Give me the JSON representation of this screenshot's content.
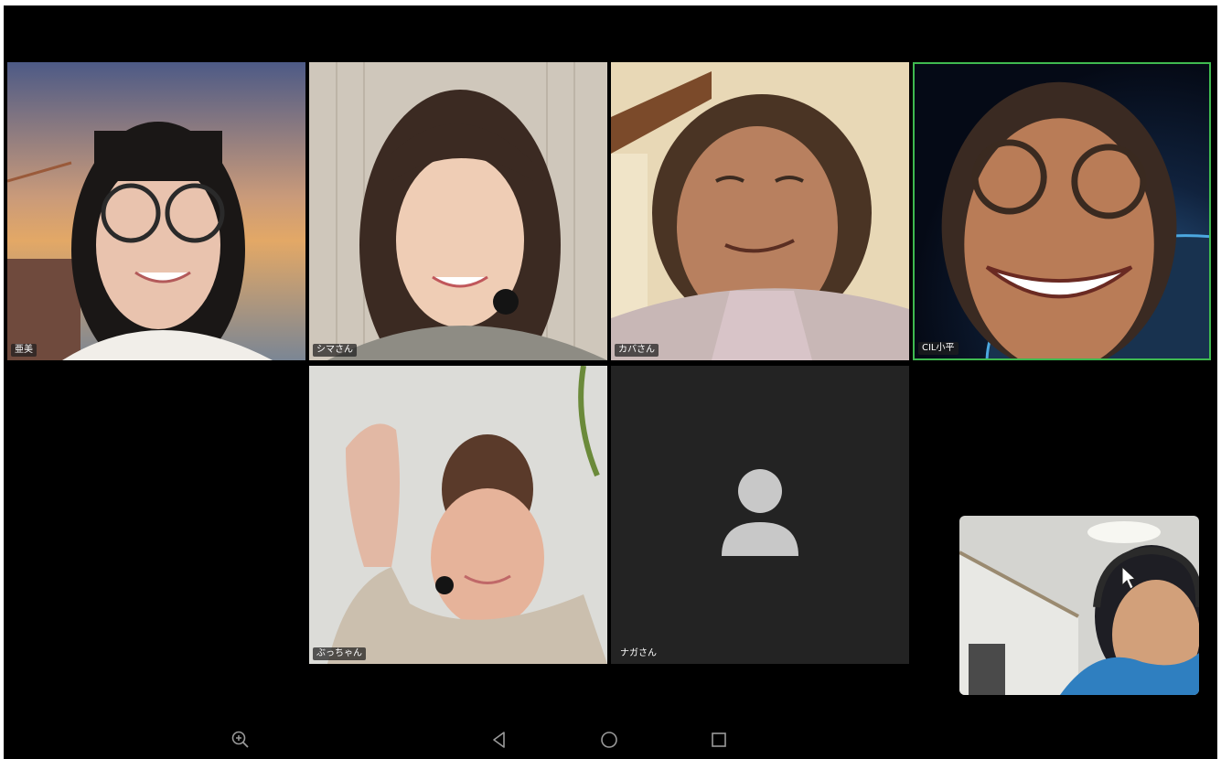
{
  "meeting": {
    "participants": [
      {
        "name": "亜美",
        "video": "on"
      },
      {
        "name": "シマさん",
        "video": "on"
      },
      {
        "name": "カバさん",
        "video": "on"
      },
      {
        "name": "CIL小平",
        "video": "on",
        "active_speaker": true
      },
      {
        "name": "ぶっちゃん",
        "video": "on"
      },
      {
        "name": "ナガさん",
        "video": "off"
      }
    ],
    "self_view": {
      "video": "on"
    }
  },
  "navbar": {
    "buttons": [
      "zoom-in-icon",
      "back-icon",
      "home-icon",
      "recents-icon"
    ]
  },
  "colors": {
    "background": "#000000",
    "active_border": "#3fb950",
    "avatar_tile": "#232323",
    "avatar_glyph": "#c8c8c8",
    "nav_icon": "#9a9a9a"
  }
}
